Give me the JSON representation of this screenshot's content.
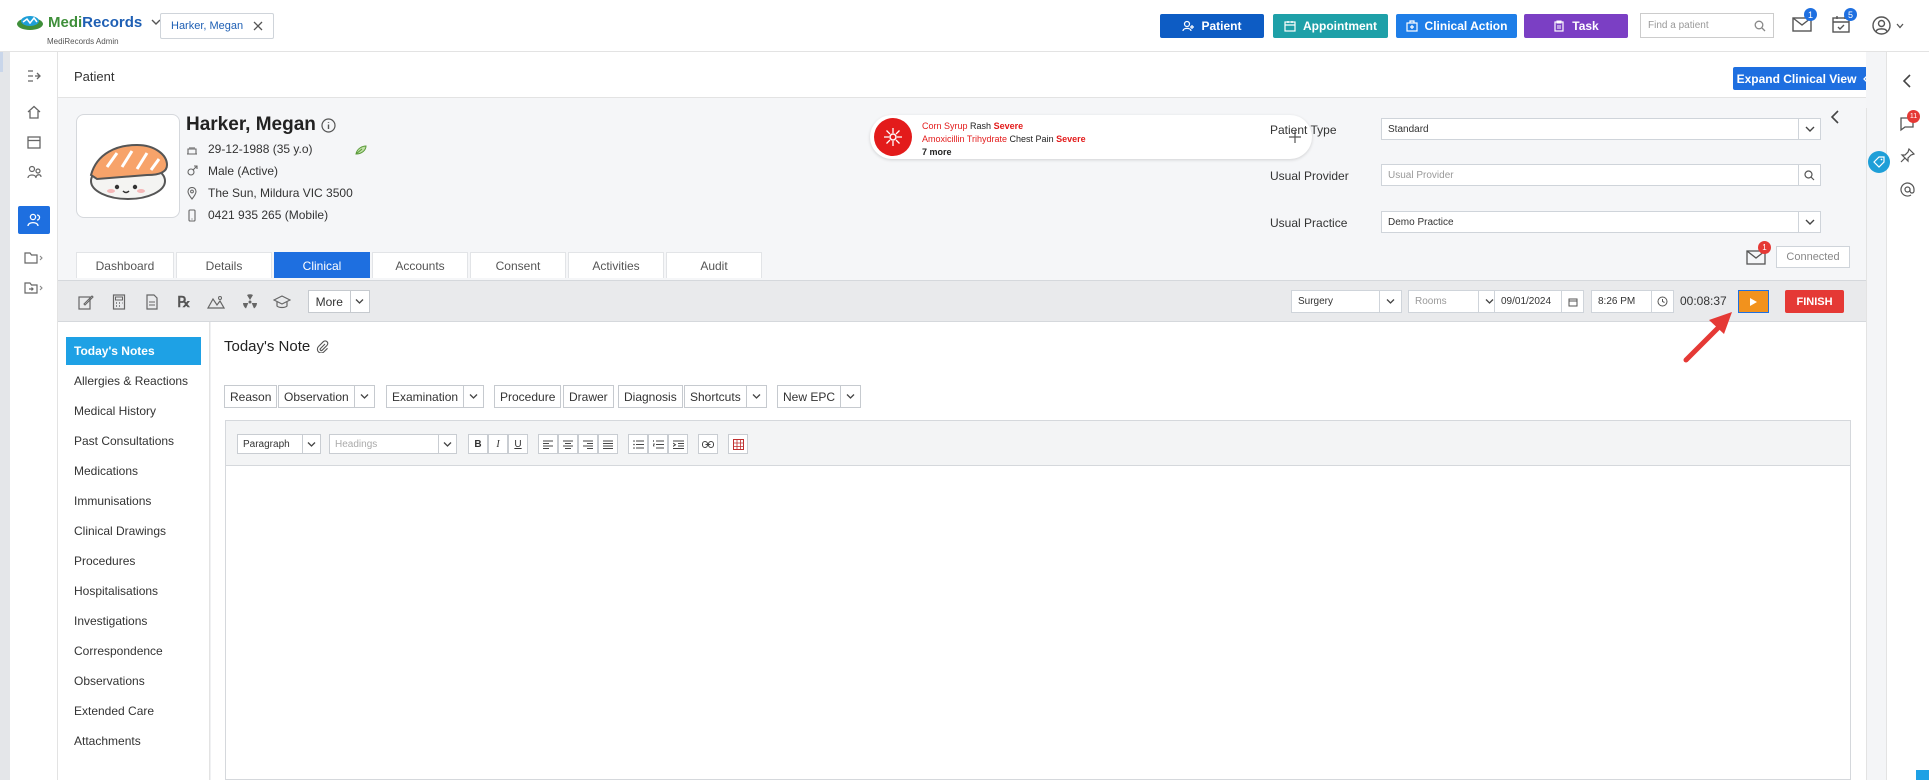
{
  "app": {
    "logo_text_a": "Medi",
    "logo_text_b": "Records",
    "logo_sub": "MediRecords Admin"
  },
  "open_patient_tab": {
    "label": "Harker, Megan"
  },
  "top_actions": {
    "patient": "Patient",
    "appointment": "Appointment",
    "clinical_action": "Clinical Action",
    "task": "Task"
  },
  "search": {
    "placeholder": "Find a patient"
  },
  "notifications": {
    "mail_count": "1",
    "tasks_count": "5"
  },
  "page": {
    "title": "Patient",
    "expand_button": "Expand Clinical View"
  },
  "patient": {
    "name": "Harker, Megan",
    "dob": "29-12-1988 (35 y.o)",
    "gender": "Male (Active)",
    "address": "The Sun, Mildura VIC 3500",
    "phone": "0421 935 265 (Mobile)"
  },
  "allergies": {
    "items": [
      {
        "substance": "Corn Syrup",
        "reaction": "Rash",
        "severity": "Severe"
      },
      {
        "substance": "Amoxicillin Trihydrate",
        "reaction": "Chest Pain",
        "severity": "Severe"
      }
    ],
    "more": "7 more"
  },
  "patient_fields": {
    "type_label": "Patient Type",
    "type_value": "Standard",
    "provider_label": "Usual Provider",
    "provider_placeholder": "Usual Provider",
    "practice_label": "Usual Practice",
    "practice_value": "Demo Practice"
  },
  "tabs": [
    "Dashboard",
    "Details",
    "Clinical",
    "Accounts",
    "Consent",
    "Activities",
    "Audit"
  ],
  "messages": {
    "count": "1",
    "connection_status": "Connected"
  },
  "toolbar": {
    "more_label": "More",
    "location": "Surgery",
    "rooms_placeholder": "Rooms",
    "date": "09/01/2024",
    "time": "8:26 PM",
    "timer": "00:08:37",
    "finish": "FINISH"
  },
  "notes_nav": [
    "Today's Notes",
    "Allergies & Reactions",
    "Medical History",
    "Past Consultations",
    "Medications",
    "Immunisations",
    "Clinical Drawings",
    "Procedures",
    "Hospitalisations",
    "Investigations",
    "Correspondence",
    "Observations",
    "Extended Care",
    "Attachments"
  ],
  "note": {
    "title": "Today's Note",
    "chips": {
      "reason": "Reason",
      "observation": "Observation",
      "examination": "Examination",
      "procedure": "Procedure",
      "drawer": "Drawer",
      "diagnosis": "Diagnosis",
      "shortcuts": "Shortcuts",
      "new_epc": "New EPC"
    },
    "format": {
      "paragraph": "Paragraph",
      "headings_placeholder": "Headings",
      "bold": "B",
      "italic": "I",
      "underline": "U"
    }
  },
  "right_rail": {
    "badge_count": "11"
  },
  "colors": {
    "patient_btn": "#0d5cc4",
    "appointment_btn": "#1ea0a8",
    "clinical_action_btn": "#1e7ee8",
    "task_btn": "#7b3fc4",
    "active_blue": "#1e6fe0",
    "notes_active": "#1ea1e5",
    "play_btn": "#f2921d",
    "finish_btn": "#e53935",
    "allergy_red": "#e31b1b",
    "arrow_red": "#e53935"
  }
}
